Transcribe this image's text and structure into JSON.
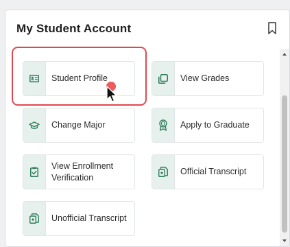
{
  "card": {
    "title": "My Student Account"
  },
  "tiles": [
    {
      "label": "Student Profile",
      "icon": "id-card-icon"
    },
    {
      "label": "View Grades",
      "icon": "copy-icon"
    },
    {
      "label": "Change Major",
      "icon": "graduation-cap-icon"
    },
    {
      "label": "Apply to Graduate",
      "icon": "award-icon"
    },
    {
      "label": "View Enrollment Verification",
      "icon": "clipboard-check-icon"
    },
    {
      "label": "Official Transcript",
      "icon": "document-icon"
    },
    {
      "label": "Unofficial Transcript",
      "icon": "document-icon"
    }
  ],
  "colors": {
    "accent": "#2e7d5b",
    "icon_bg": "#e6f0ec",
    "highlight": "#e0474c"
  }
}
